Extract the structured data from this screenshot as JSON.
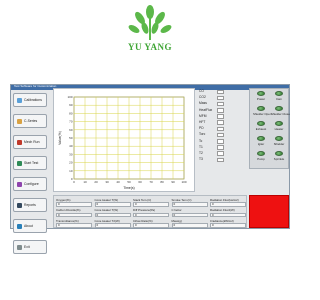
{
  "brand": {
    "name": "YU YANG",
    "color": "#3fa535"
  },
  "window": {
    "title": "Test Software for Customization"
  },
  "sidebar": {
    "items": [
      {
        "label": "Calibrations",
        "icon": "calibration-icon",
        "color": "#5aa0d8"
      },
      {
        "label": "C-Series",
        "icon": "series-icon",
        "color": "#d9a243"
      },
      {
        "label": "Mech Run",
        "icon": "mech-icon",
        "color": "#c0392b"
      },
      {
        "label": "Start Test",
        "icon": "play-icon",
        "color": "#2e8b57"
      },
      {
        "label": "Configure",
        "icon": "gear-icon",
        "color": "#8e44ad"
      },
      {
        "label": "Reports",
        "icon": "report-icon",
        "color": "#34495e"
      },
      {
        "label": "About",
        "icon": "info-icon",
        "color": "#2980b9"
      },
      {
        "label": "Exit",
        "icon": "exit-icon",
        "color": "#7f8c8d"
      }
    ]
  },
  "chart_data": {
    "type": "line",
    "title": "",
    "xlabel": "Time(s)",
    "ylabel": "Value(%)",
    "xlim": [
      0,
      100
    ],
    "ylim": [
      0,
      100
    ],
    "x_ticks": [
      "0",
      "10",
      "20",
      "30",
      "40",
      "50",
      "60",
      "70",
      "80",
      "90",
      "100"
    ],
    "y_ticks": [
      "0",
      "10",
      "20",
      "30",
      "40",
      "50",
      "60",
      "70",
      "80",
      "90",
      "100"
    ],
    "grid": true,
    "grid_color": "#d8d44a",
    "series": []
  },
  "legend": {
    "items": [
      "CO",
      "CO2",
      "Mass",
      "HeatFlux",
      "MFM",
      "HFT",
      "PD",
      "Torc",
      "Tc",
      "T1",
      "T2",
      "T3"
    ]
  },
  "controls": [
    {
      "label": "Power"
    },
    {
      "label": "Cam"
    },
    {
      "label": "Shielder Open"
    },
    {
      "label": "Shielder Close"
    },
    {
      "label": "Exhaust"
    },
    {
      "label": "Heater"
    },
    {
      "label": "Igiter"
    },
    {
      "label": "Shielder"
    },
    {
      "label": "Pump"
    },
    {
      "label": "Sprinkle"
    }
  ],
  "fields": [
    {
      "label": "Oxygen(%)",
      "value": "0"
    },
    {
      "label": "Cone Heater T(W)",
      "value": "0"
    },
    {
      "label": "Stack Tem.(C)",
      "value": "0"
    },
    {
      "label": "Smoke Tem.(C)",
      "value": "0"
    },
    {
      "label": "Radiation Flux(kw/m2)",
      "value": "0"
    },
    {
      "label": "Carbon Dioxide(%)",
      "value": "0"
    },
    {
      "label": "Cone Heater T(W)",
      "value": "0"
    },
    {
      "label": "Diff Pressure(Pa)",
      "value": "0"
    },
    {
      "label": "C factor",
      "value": "0"
    },
    {
      "label": "Radiation Flux2(W)",
      "value": "0"
    },
    {
      "label": "Transmittance(%)",
      "value": "0"
    },
    {
      "label": "Cone Heater T2(W)",
      "value": "0"
    },
    {
      "label": "Inflow Ratio(%)",
      "value": "0"
    },
    {
      "label": "Mass(g)",
      "value": "0"
    },
    {
      "label": "Irradiance(kW/m2)",
      "value": "0"
    }
  ],
  "status": {
    "alarm_color": "#ee1111"
  }
}
